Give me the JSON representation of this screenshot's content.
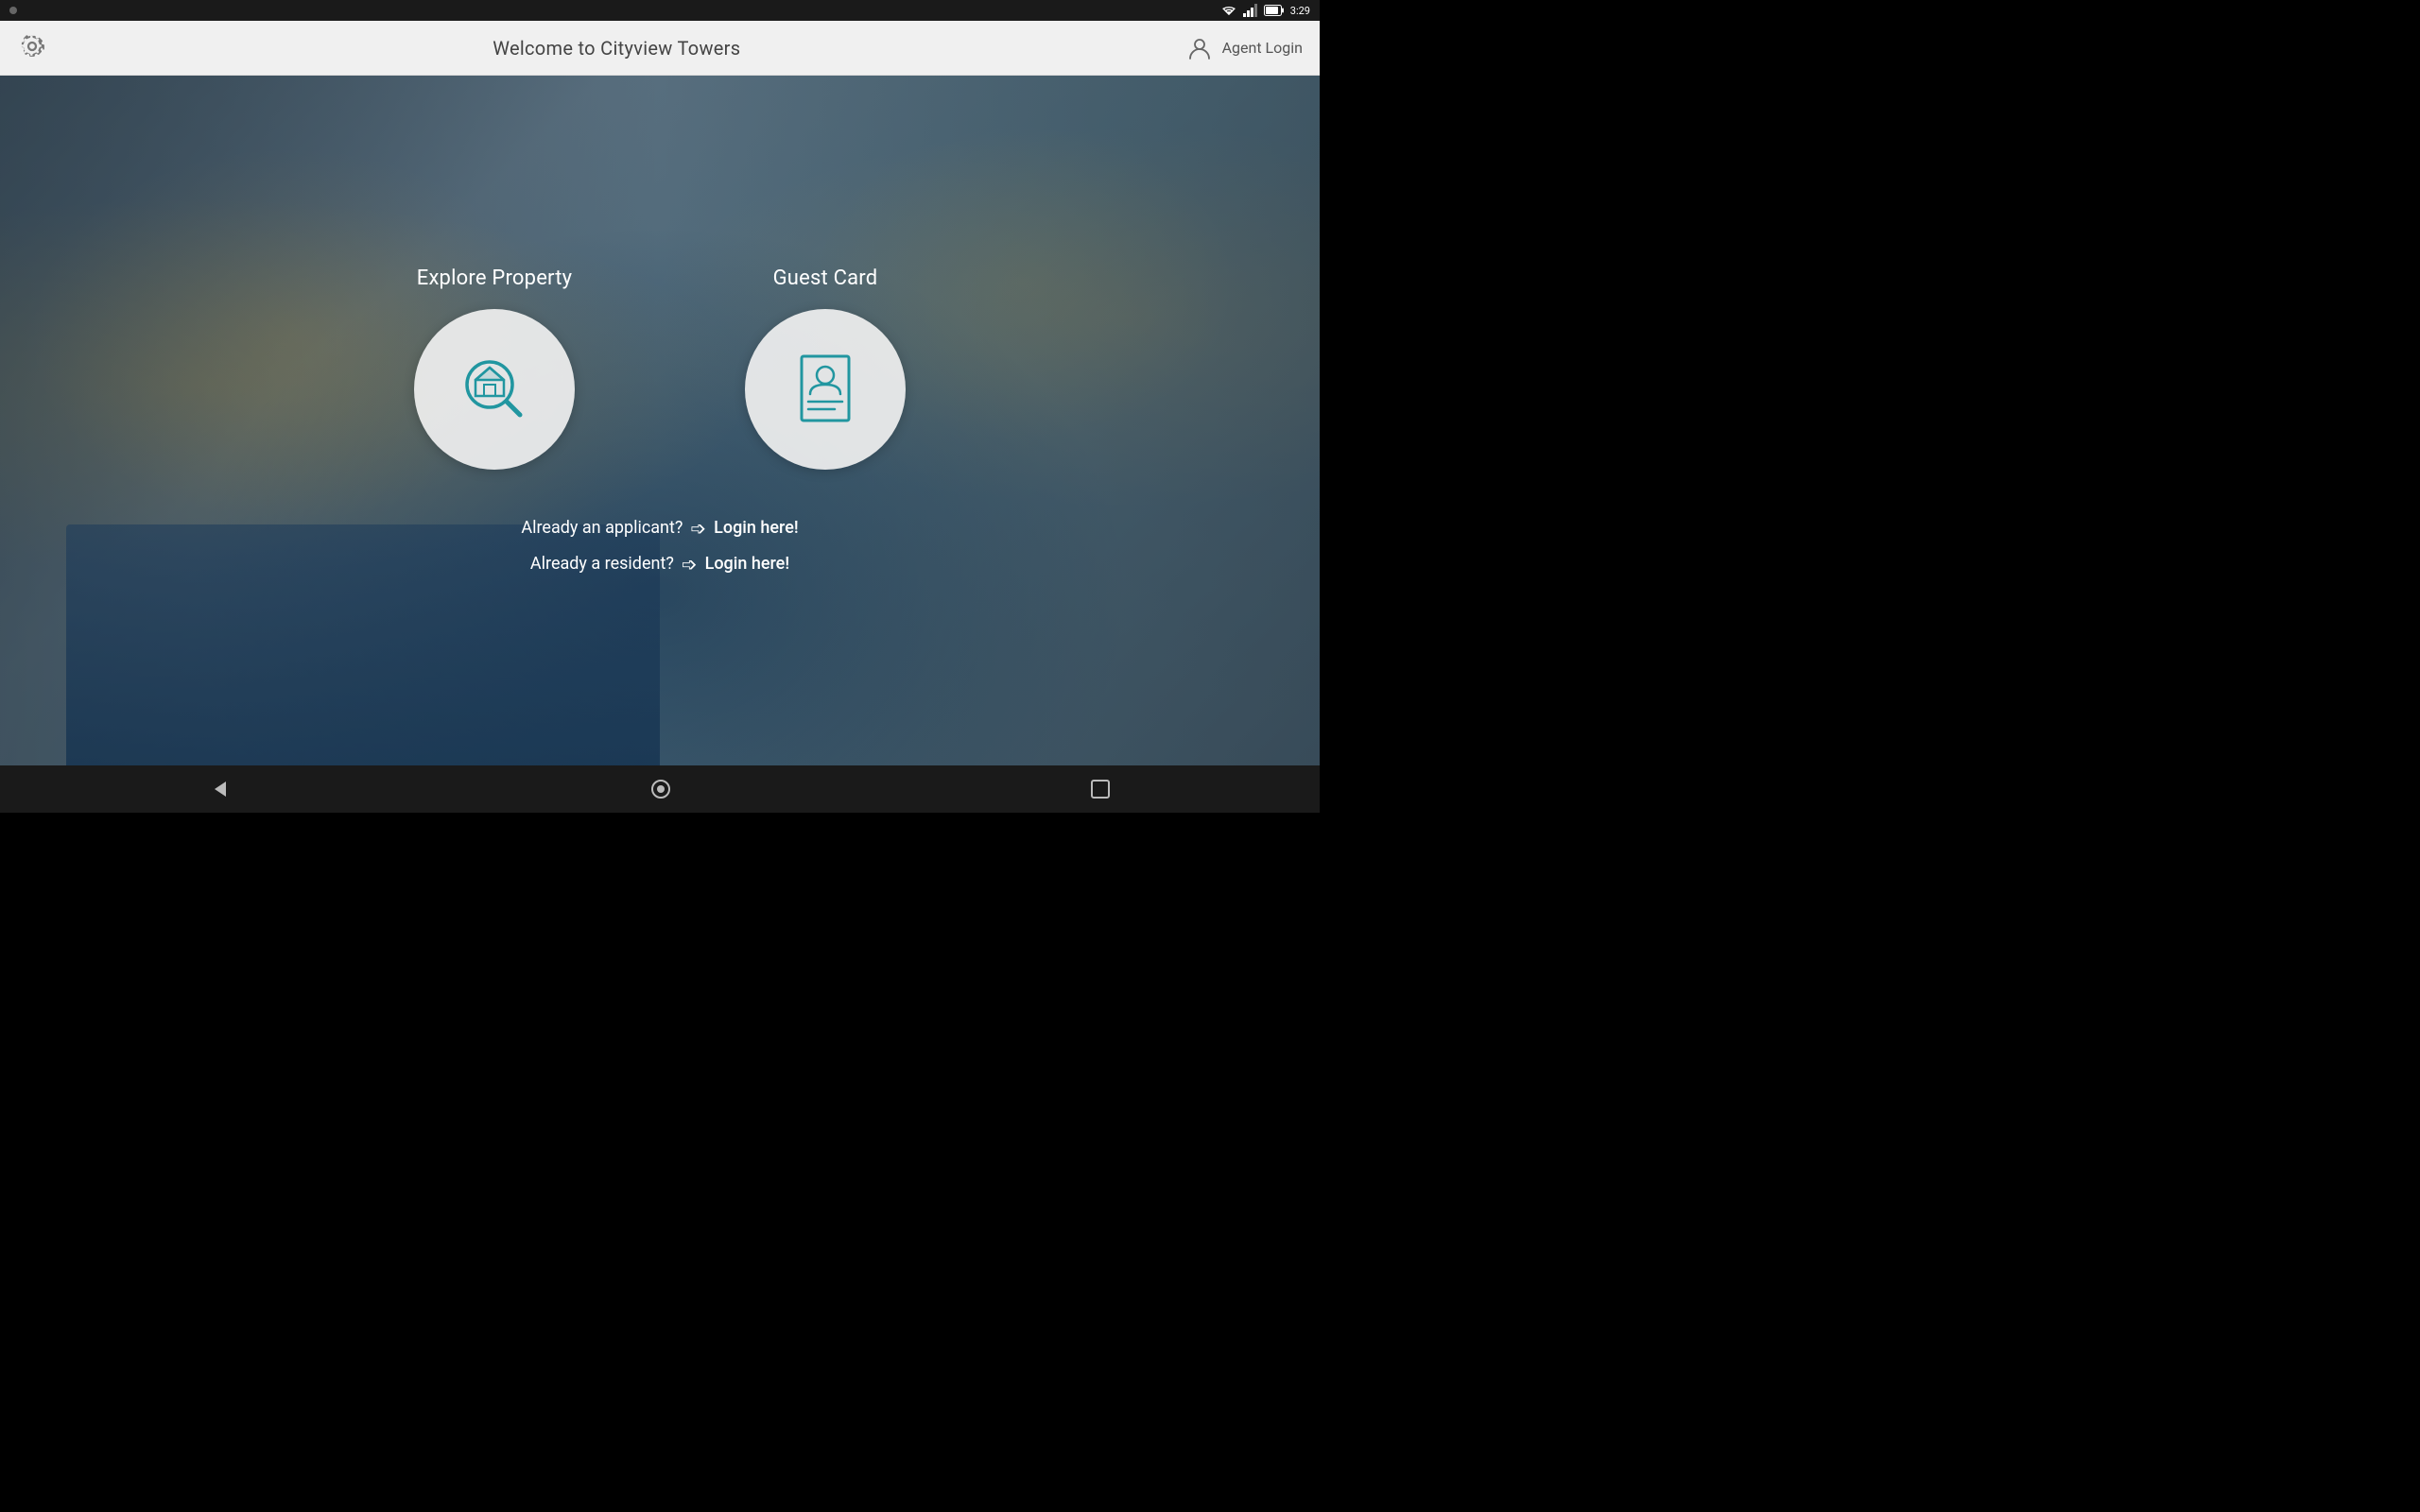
{
  "status_bar": {
    "time": "3:29",
    "dot_label": "status-dot"
  },
  "top_bar": {
    "settings_label": "settings",
    "title": "Welcome to Cityview Towers",
    "agent_login_label": "Agent Login"
  },
  "explore_card": {
    "label": "Explore Property"
  },
  "guest_card": {
    "label": "Guest Card"
  },
  "login_links": {
    "applicant_text": "Already an applicant?",
    "applicant_action": "Login here!",
    "resident_text": "Already a resident?",
    "resident_action": "Login here!"
  },
  "bottom_nav": {
    "back_label": "back",
    "home_label": "home",
    "recent_label": "recent"
  }
}
